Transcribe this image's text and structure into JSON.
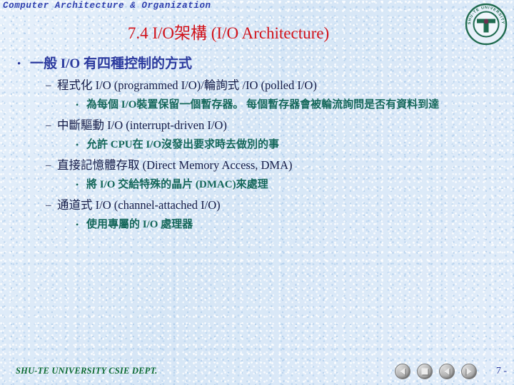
{
  "header": {
    "course": "Computer Architecture & Organization"
  },
  "logo": {
    "ring_text": "SHU-TE UNIVERSITY",
    "monogram": "T",
    "color": "#1f6b4f"
  },
  "title": {
    "text": "7.4 I/O架構 (I/O Architecture)",
    "color": "#d2121a"
  },
  "colors": {
    "background": "#dde9f8",
    "level1_text": "#2b3a9e",
    "level2_text": "#141b47",
    "level3_text": "#14675a",
    "footer_text": "#0d6b33",
    "header_text": "#2e3fae"
  },
  "content": {
    "bullet_marker_level1": "•",
    "bullet_marker_level2": "–",
    "bullet_marker_level3": "•",
    "level1": "一般 I/O 有四種控制的方式",
    "items": [
      {
        "heading": "程式化 I/O (programmed I/O)/輪詢式 /IO (polled I/O)",
        "detail": "為每個 I/O裝置保留一個暫存器。   每個暫存器會被輪流詢問是否有資料到達"
      },
      {
        "heading": "中斷驅動 I/O (interrupt-driven I/O)",
        "detail": "允許 CPU在 I/O沒發出要求時去做別的事"
      },
      {
        "heading": "直接記憶體存取  (Direct Memory Access, DMA)",
        "detail": "將 I/O 交給特殊的晶片  (DMAC)來處理"
      },
      {
        "heading": "通道式 I/O (channel-attached I/O)",
        "detail": "使用專屬的  I/O 處理器"
      }
    ]
  },
  "footer": {
    "school": "SHU-TE UNIVERSITY  CSIE DEPT.",
    "page": "7 -",
    "nav": [
      {
        "name": "first-slide-button",
        "glyph": "triangle-left"
      },
      {
        "name": "stop-button",
        "glyph": "square"
      },
      {
        "name": "previous-slide-button",
        "glyph": "triangle-left"
      },
      {
        "name": "next-slide-button",
        "glyph": "triangle-right"
      }
    ]
  }
}
